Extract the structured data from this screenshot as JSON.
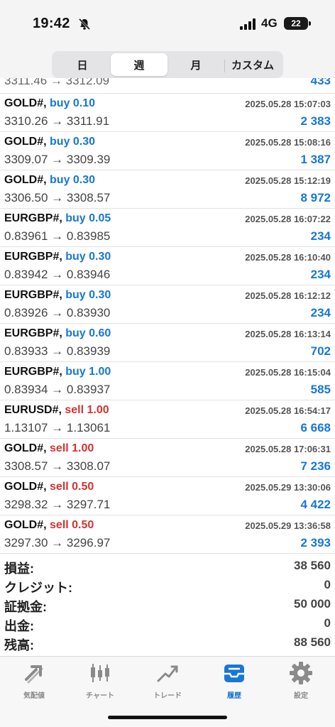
{
  "status": {
    "time": "19:42",
    "network": "4G",
    "battery": "22"
  },
  "segments": [
    {
      "label": "日",
      "active": false
    },
    {
      "label": "週",
      "active": true
    },
    {
      "label": "月",
      "active": false
    },
    {
      "label": "カスタム",
      "active": false
    }
  ],
  "partial_row": {
    "prices": "3311.46 → 3312.09",
    "profit": "433"
  },
  "trades": [
    {
      "symbol": "GOLD#,",
      "side": "buy 0.10",
      "datetime": "2025.05.28 15:07:03",
      "prices": "3310.26 → 3311.91",
      "profit": "2 383"
    },
    {
      "symbol": "GOLD#,",
      "side": "buy 0.30",
      "datetime": "2025.05.28 15:08:16",
      "prices": "3309.07 → 3309.39",
      "profit": "1 387"
    },
    {
      "symbol": "GOLD#,",
      "side": "buy 0.30",
      "datetime": "2025.05.28 15:12:19",
      "prices": "3306.50 → 3308.57",
      "profit": "8 972"
    },
    {
      "symbol": "EURGBP#,",
      "side": "buy 0.05",
      "datetime": "2025.05.28 16:07:22",
      "prices": "0.83961 → 0.83985",
      "profit": "234"
    },
    {
      "symbol": "EURGBP#,",
      "side": "buy 0.30",
      "datetime": "2025.05.28 16:10:40",
      "prices": "0.83942 → 0.83946",
      "profit": "234"
    },
    {
      "symbol": "EURGBP#,",
      "side": "buy 0.30",
      "datetime": "2025.05.28 16:12:12",
      "prices": "0.83926 → 0.83930",
      "profit": "234"
    },
    {
      "symbol": "EURGBP#,",
      "side": "buy 0.60",
      "datetime": "2025.05.28 16:13:14",
      "prices": "0.83933 → 0.83939",
      "profit": "702"
    },
    {
      "symbol": "EURGBP#,",
      "side": "buy 1.00",
      "datetime": "2025.05.28 16:15:04",
      "prices": "0.83934 → 0.83937",
      "profit": "585"
    },
    {
      "symbol": "EURUSD#,",
      "side": "sell 1.00",
      "datetime": "2025.05.28 16:54:17",
      "prices": "1.13107 → 1.13061",
      "profit": "6 668"
    },
    {
      "symbol": "GOLD#,",
      "side": "sell 1.00",
      "datetime": "2025.05.28 17:06:31",
      "prices": "3308.57 → 3308.07",
      "profit": "7 236"
    },
    {
      "symbol": "GOLD#,",
      "side": "sell 0.50",
      "datetime": "2025.05.29 13:30:06",
      "prices": "3298.32 → 3297.71",
      "profit": "4 422"
    },
    {
      "symbol": "GOLD#,",
      "side": "sell 0.50",
      "datetime": "2025.05.29 13:36:58",
      "prices": "3297.30 → 3296.97",
      "profit": "2 393"
    }
  ],
  "summary": [
    {
      "label": "損益:",
      "value": "38 560"
    },
    {
      "label": "クレジット:",
      "value": "0"
    },
    {
      "label": "証拠金:",
      "value": "50 000"
    },
    {
      "label": "出金:",
      "value": "0"
    },
    {
      "label": "残高:",
      "value": "88 560"
    }
  ],
  "tabs": [
    {
      "label": "気配値",
      "icon": "quotes-icon",
      "active": false
    },
    {
      "label": "チャート",
      "icon": "candlestick-chart-icon",
      "active": false
    },
    {
      "label": "トレード",
      "icon": "trade-icon",
      "active": false
    },
    {
      "label": "履歴",
      "icon": "history-inbox-icon",
      "active": true
    },
    {
      "label": "設定",
      "icon": "gear-icon",
      "active": false
    }
  ],
  "colors": {
    "buy": "#1877d6",
    "sell": "#d63131",
    "profit": "#1877d6",
    "active_tab": "#1877d6",
    "inactive_tab": "#8a8a8a"
  }
}
